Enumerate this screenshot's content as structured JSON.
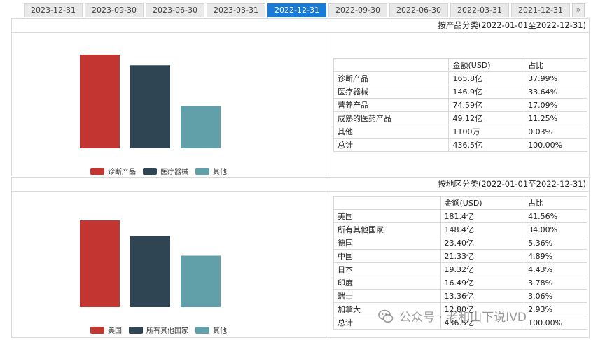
{
  "tabs": [
    {
      "label": "2023-12-31",
      "active": false
    },
    {
      "label": "2023-09-30",
      "active": false
    },
    {
      "label": "2023-06-30",
      "active": false
    },
    {
      "label": "2023-03-31",
      "active": false
    },
    {
      "label": "2022-12-31",
      "active": true
    },
    {
      "label": "2022-09-30",
      "active": false
    },
    {
      "label": "2022-06-30",
      "active": false
    },
    {
      "label": "2022-03-31",
      "active": false
    },
    {
      "label": "2021-12-31",
      "active": false
    }
  ],
  "tab_more": "»",
  "colors": {
    "red": "#c23531",
    "navy": "#2f4554",
    "teal": "#61a0a8",
    "active_tab": "#1a7bd6"
  },
  "product": {
    "title": "按产品分类(2022-01-01至2022-12-31)",
    "headers": [
      "",
      "金额(USD)",
      "占比"
    ],
    "rows": [
      [
        "诊断产品",
        "165.8亿",
        "37.99%"
      ],
      [
        "医疗器械",
        "146.9亿",
        "33.64%"
      ],
      [
        "营养产品",
        "74.59亿",
        "17.09%"
      ],
      [
        "成熟的医药产品",
        "49.12亿",
        "11.25%"
      ],
      [
        "其他",
        "1100万",
        "0.03%"
      ],
      [
        "总计",
        "436.5亿",
        "100.00%"
      ]
    ]
  },
  "region": {
    "title": "按地区分类(2022-01-01至2022-12-31)",
    "headers": [
      "",
      "金额(USD)",
      "占比"
    ],
    "rows": [
      [
        "美国",
        "181.4亿",
        "41.56%"
      ],
      [
        "所有其他国家",
        "148.4亿",
        "34.00%"
      ],
      [
        "德国",
        "23.40亿",
        "5.36%"
      ],
      [
        "中国",
        "21.33亿",
        "4.89%"
      ],
      [
        "日本",
        "19.32亿",
        "4.43%"
      ],
      [
        "印度",
        "16.49亿",
        "3.78%"
      ],
      [
        "瑞士",
        "13.36亿",
        "3.06%"
      ],
      [
        "加拿大",
        "12.80亿",
        "2.93%"
      ],
      [
        "总计",
        "436.5亿",
        "100.00%"
      ]
    ]
  },
  "chart_data": [
    {
      "type": "bar",
      "categories": [
        "诊断产品",
        "医疗器械",
        "其他"
      ],
      "values": [
        165.8,
        146.9,
        74.59
      ],
      "colors": [
        "#c23531",
        "#2f4554",
        "#61a0a8"
      ],
      "legend": [
        "诊断产品",
        "医疗器械",
        "其他"
      ],
      "legend_placement": "bottom",
      "grid": false,
      "ylim": [
        0,
        165.8
      ]
    },
    {
      "type": "bar",
      "categories": [
        "美国",
        "所有其他国家",
        "其他"
      ],
      "values": [
        181.4,
        148.4,
        107.5
      ],
      "colors": [
        "#c23531",
        "#2f4554",
        "#61a0a8"
      ],
      "legend": [
        "美国",
        "所有其他国家",
        "其他"
      ],
      "legend_placement": "bottom",
      "grid": false,
      "ylim": [
        0,
        181.4
      ]
    }
  ],
  "watermark": {
    "text": "公众号 · 老和山下说IVD"
  }
}
